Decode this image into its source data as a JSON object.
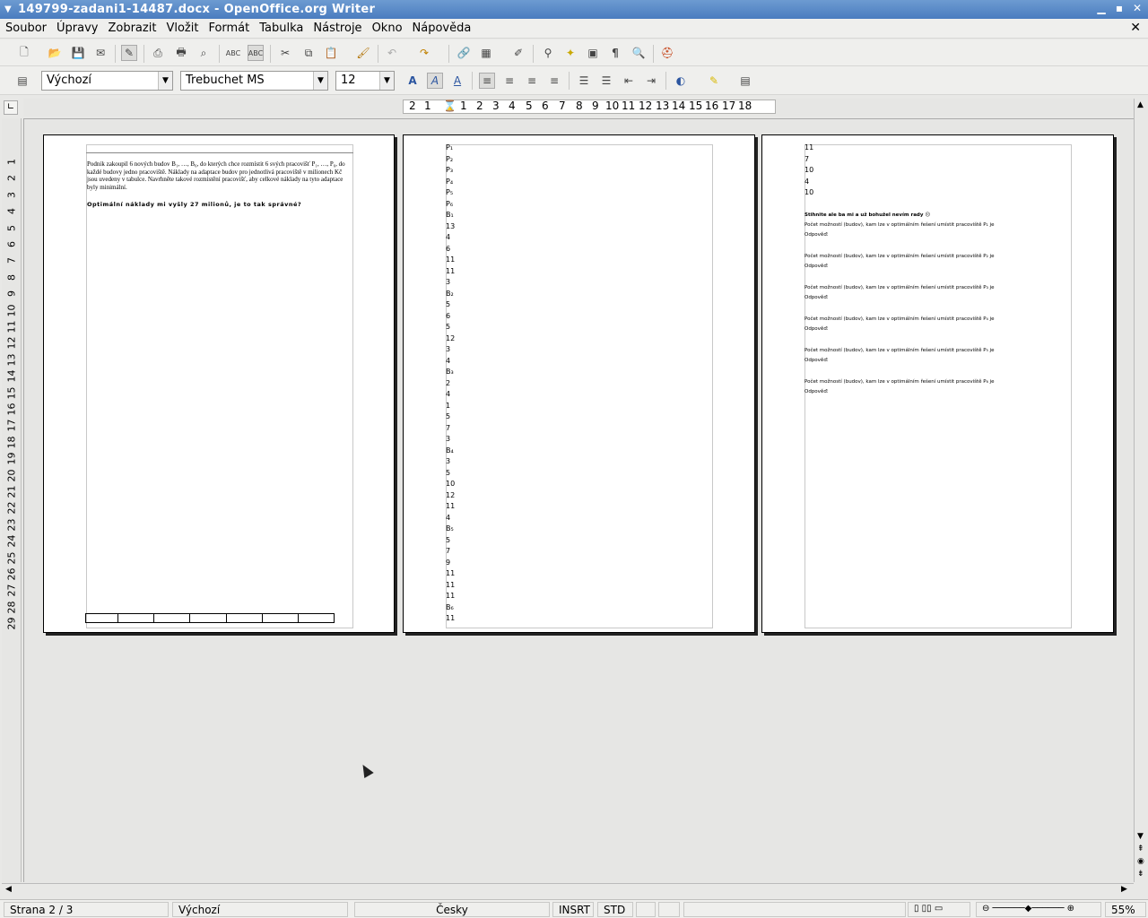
{
  "window": {
    "title": "149799-zadani1-14487.docx - OpenOffice.org Writer"
  },
  "menu": [
    "Soubor",
    "Úpravy",
    "Zobrazit",
    "Vložit",
    "Formát",
    "Tabulka",
    "Nástroje",
    "Okno",
    "Nápověda"
  ],
  "format_bar": {
    "style": "Výchozí",
    "font": "Trebuchet MS",
    "size": "12"
  },
  "ruler": {
    "h_ticks": [
      "2",
      "1",
      "1",
      "2",
      "3",
      "4",
      "5",
      "6",
      "7",
      "8",
      "9",
      "10",
      "11",
      "12",
      "13",
      "14",
      "15",
      "16",
      "17",
      "18"
    ],
    "v_ticks": [
      "1",
      "2",
      "3",
      "4",
      "5",
      "6",
      "7",
      "8",
      "9",
      "10",
      "11",
      "12",
      "13",
      "14",
      "15",
      "16",
      "17",
      "18",
      "19",
      "20",
      "21",
      "22",
      "23",
      "24",
      "25",
      "26",
      "27",
      "28",
      "29"
    ]
  },
  "page1": {
    "paragraph": "Podnik zakoupil 6 nových budov B₁, …, B₆, do kterých chce rozmístit 6 svých pracovišť P₁, …, P₆, do každé budovy jedno pracoviště. Náklady na adaptace budov pro jednotlivá pracoviště v milionech Kč jsou uvedeny v tabulce. Navrhněte takové rozmístění pracovišť, aby celkové náklady na tyto adaptace byly minimální.",
    "question": "Optimální náklady mi vyšly 27 milionů, je to tak správné?"
  },
  "page2": {
    "lines": [
      "P₁",
      "P₂",
      "P₃",
      "P₄",
      "P₅",
      "P₆",
      "B₁",
      "13",
      "4",
      "6",
      "11",
      "11",
      "3",
      "B₂",
      "5",
      "6",
      "5",
      "12",
      "3",
      "4",
      "B₃",
      "2",
      "4",
      "1",
      "5",
      "7",
      "3",
      "B₄",
      "3",
      "5",
      "10",
      "12",
      "11",
      "4",
      "B₅",
      "5",
      "7",
      "9",
      "11",
      "11",
      "11",
      "B₆",
      "11"
    ]
  },
  "page3": {
    "lines": [
      "11",
      "7",
      "10",
      "4",
      "10"
    ],
    "heading": "Stihnite ale ba mi a už bohužel nevím rady ☹",
    "qa": [
      {
        "q": "Počet možností (budov), kam lze v optimálním řešení umístit pracoviště P₁ je",
        "a": "Odpověď:"
      },
      {
        "q": "Počet možností (budov), kam lze v optimálním řešení umístit pracoviště P₂ je",
        "a": "Odpověď:"
      },
      {
        "q": "Počet možností (budov), kam lze v optimálním řešení umístit pracoviště P₃ je",
        "a": "Odpověď:"
      },
      {
        "q": "Počet možností (budov), kam lze v optimálním řešení umístit pracoviště P₄ je",
        "a": "Odpověď:"
      },
      {
        "q": "Počet možností (budov), kam lze v optimálním řešení umístit pracoviště P₅ je",
        "a": "Odpověď:"
      },
      {
        "q": "Počet možností (budov), kam lze v optimálním řešení umístit pracoviště P₆ je",
        "a": "Odpověď:"
      }
    ]
  },
  "status": {
    "page": "Strana 2 / 3",
    "style": "Výchozí",
    "language": "Česky",
    "insert": "INSRT",
    "selection": "STD",
    "zoom": "55%"
  }
}
